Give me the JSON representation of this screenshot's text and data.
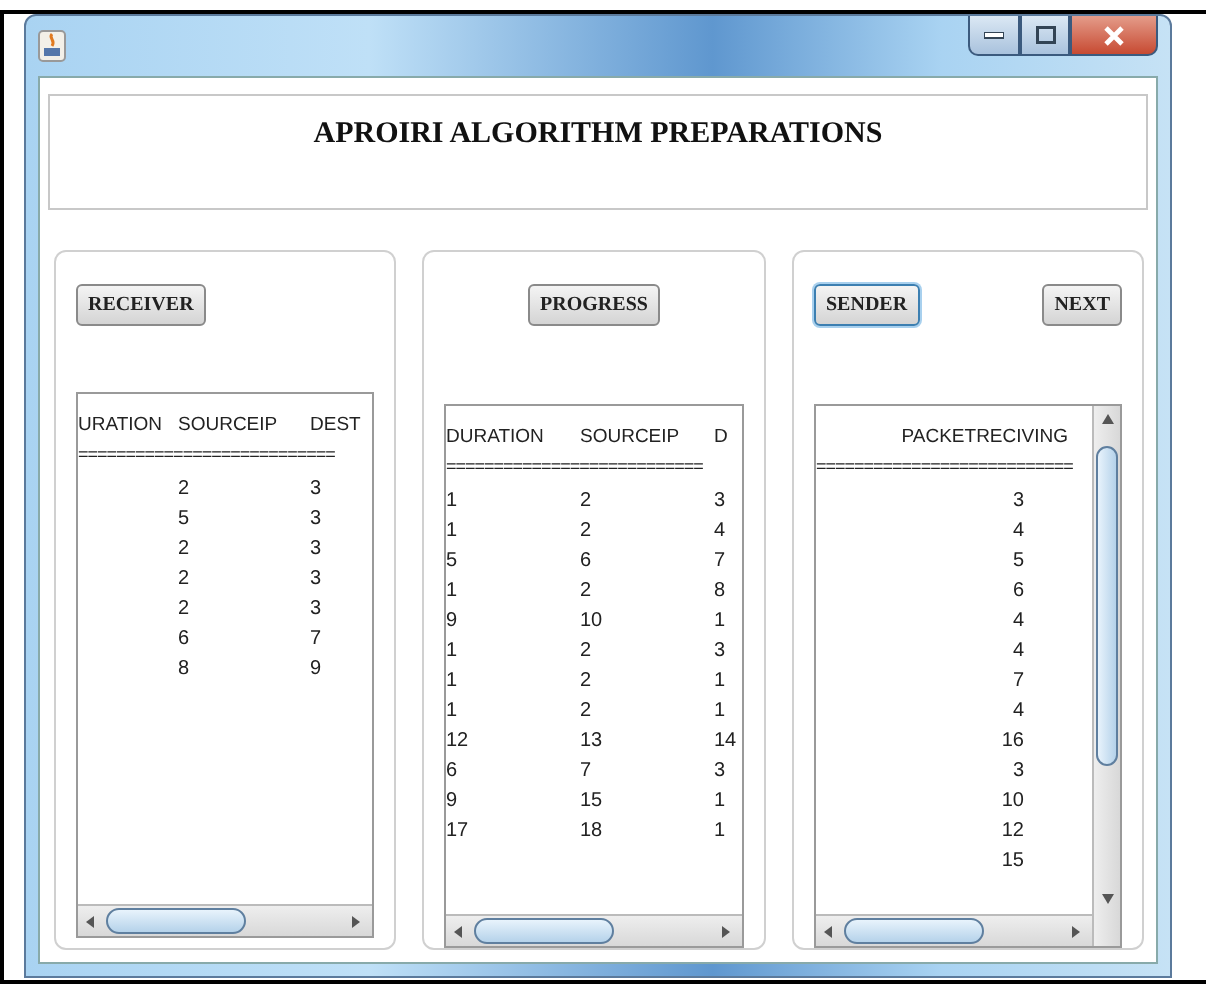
{
  "header": {
    "title": "APROIRI ALGORITHM PREPARATIONS"
  },
  "panels": [
    {
      "kind": "receiver",
      "buttons": [
        {
          "label": "RECEIVER",
          "focused": false
        }
      ],
      "table": {
        "rule": "===========================",
        "columns": [
          {
            "header": "URATION"
          },
          {
            "header": "SOURCEIP",
            "values": [
              "2",
              "5",
              "2",
              "2",
              "2",
              "6",
              "8"
            ]
          },
          {
            "header": "DEST",
            "values": [
              "3",
              "3",
              "3",
              "3",
              "3",
              "7",
              "9"
            ]
          }
        ]
      }
    },
    {
      "kind": "progress",
      "buttons": [
        {
          "label": "PROGRESS",
          "focused": false
        }
      ],
      "table": {
        "rule": "===========================",
        "columns": [
          {
            "header": "DURATION",
            "values": [
              "1",
              "1",
              "5",
              "1",
              "9",
              "1",
              "1",
              "1",
              "12",
              "6",
              "9",
              "17"
            ]
          },
          {
            "header": "SOURCEIP",
            "values": [
              "2",
              "2",
              "6",
              "2",
              "10",
              "2",
              "2",
              "2",
              "13",
              "7",
              "15",
              "18"
            ]
          },
          {
            "header": "D",
            "values": [
              "3",
              "4",
              "7",
              "8",
              "1",
              "3",
              "1",
              "1",
              "14",
              "3",
              "1",
              "1"
            ]
          }
        ]
      }
    },
    {
      "kind": "sender",
      "buttons": [
        {
          "label": "SENDER",
          "focused": true
        },
        {
          "label": "NEXT",
          "focused": false
        }
      ],
      "table": {
        "rule": "===========================",
        "columns": [
          {
            "header": "PACKETRECIVING",
            "values": [
              "3",
              "4",
              "5",
              "6",
              "4",
              "4",
              "7",
              "4",
              "16",
              "3",
              "10",
              "12",
              "15"
            ]
          }
        ]
      }
    }
  ]
}
